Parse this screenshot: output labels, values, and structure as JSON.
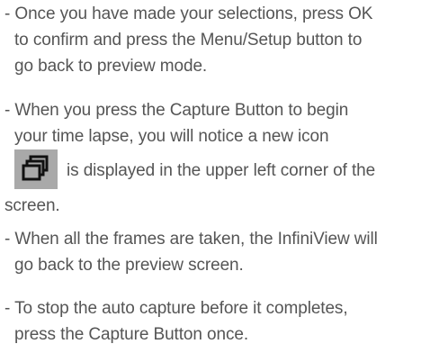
{
  "items": [
    {
      "lines": [
        "- Once you have made your selections, press OK",
        "to confirm and press the Menu/Setup button to",
        "go back to preview mode."
      ]
    },
    {
      "lines": [
        "- When you press the Capture Button to begin",
        "your time lapse, you will notice a new icon"
      ],
      "icon_row_text": "is displayed in the upper left corner of the",
      "tail": "screen.",
      "icon": "stacked-frames-icon"
    },
    {
      "lines": [
        "- When all the frames are taken, the InfiniView will",
        "go back to the preview screen."
      ]
    },
    {
      "lines": [
        "- To stop the auto capture before it completes,",
        "press the Capture Button once."
      ]
    }
  ],
  "colors": {
    "text": "#555555",
    "icon_bg": "#a9a9a9",
    "icon_stroke": "#111111"
  }
}
